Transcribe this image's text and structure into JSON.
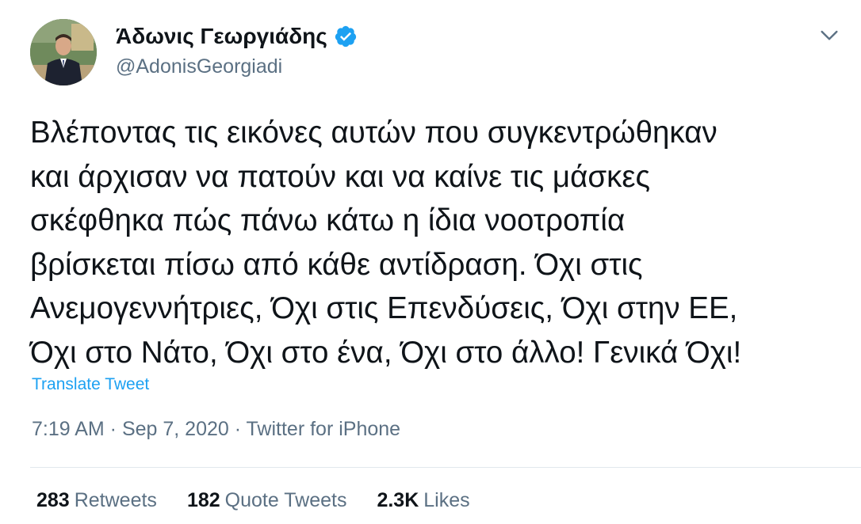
{
  "author": {
    "name": "Άδωνις Γεωργιάδης",
    "handle": "@AdonisGeorgiadi",
    "verified": true
  },
  "tweet": {
    "lines": [
      "Βλέποντας τις εικόνες αυτών που συγκεντρώθηκαν",
      "και άρχισαν να πατούν και να καίνε τις μάσκες",
      "σκέφθηκα πώς πάνω κάτω η ίδια νοοτροπία",
      "βρίσκεται πίσω από κάθε αντίδραση. Όχι στις",
      "Ανεμογεννήτριες, Όχι στις Επενδύσεις, Όχι στην ΕΕ,",
      "Όχι στο Νάτο, Όχι στο ένα, Όχι στο άλλο! Γενικά Όχι!"
    ],
    "translate_label": "Translate Tweet",
    "meta": "7:19 AM · Sep 7, 2020 · Twitter for iPhone"
  },
  "stats": {
    "retweets_count": "283",
    "retweets_label": "Retweets",
    "quotes_count": "182",
    "quotes_label": "Quote Tweets",
    "likes_count": "2.3K",
    "likes_label": "Likes"
  },
  "colors": {
    "accent": "#1da1f2",
    "secondary_text": "#5b7083",
    "primary_text": "#0f1419"
  },
  "icons": {
    "verified": "verified-badge-icon",
    "more": "chevron-down-icon"
  }
}
